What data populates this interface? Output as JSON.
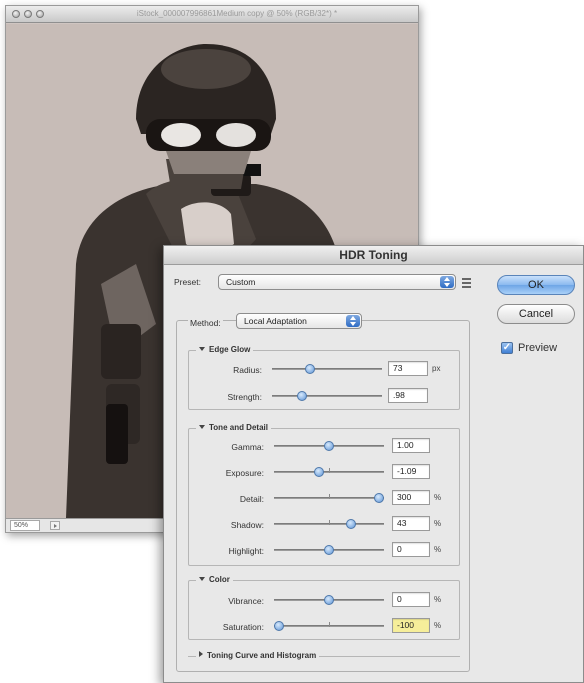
{
  "document": {
    "title": "iStock_000007996861Medium copy @ 50% (RGB/32*) *",
    "zoom": "50%"
  },
  "dialog": {
    "title": "HDR Toning",
    "preset_label": "Preset:",
    "preset_value": "Custom",
    "method_label": "Method:",
    "method_value": "Local Adaptation",
    "ok_label": "OK",
    "cancel_label": "Cancel",
    "preview_label": "Preview",
    "preview_checked": true,
    "edge_glow": {
      "title": "Edge Glow",
      "radius": {
        "label": "Radius:",
        "value": "73",
        "unit": "px",
        "level": 0.33
      },
      "strength": {
        "label": "Strength:",
        "value": ".98",
        "unit": "",
        "level": 0.25
      }
    },
    "tone_detail": {
      "title": "Tone and Detail",
      "gamma": {
        "label": "Gamma:",
        "value": "1.00",
        "unit": "",
        "level": 0.5
      },
      "exposure": {
        "label": "Exposure:",
        "value": "-1.09",
        "unit": "",
        "level": 0.4
      },
      "detail": {
        "label": "Detail:",
        "value": "300",
        "unit": "%",
        "level": 1.0
      },
      "shadow": {
        "label": "Shadow:",
        "value": "43",
        "unit": "%",
        "level": 0.72
      },
      "highlight": {
        "label": "Highlight:",
        "value": "0",
        "unit": "%",
        "level": 0.5
      }
    },
    "color": {
      "title": "Color",
      "vibrance": {
        "label": "Vibrance:",
        "value": "0",
        "unit": "%",
        "level": 0.5
      },
      "saturation": {
        "label": "Saturation:",
        "value": "-100",
        "unit": "%",
        "level": 0.0
      }
    },
    "toning_curve_label": "Toning Curve and Histogram"
  }
}
